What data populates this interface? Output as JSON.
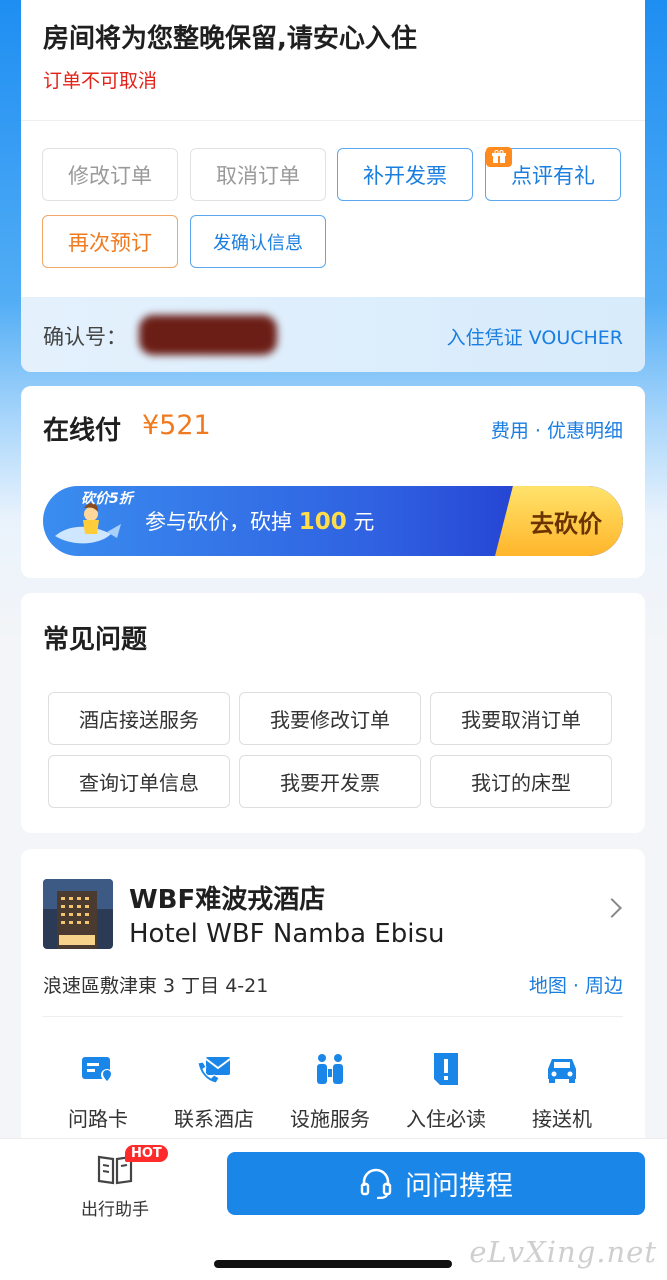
{
  "order_status": {
    "title": "房间将为您整晚保留,请安心入住",
    "subtitle": "订单不可取消"
  },
  "actions": [
    {
      "label": "修改订单",
      "style": "gray"
    },
    {
      "label": "取消订单",
      "style": "gray"
    },
    {
      "label": "补开发票",
      "style": "blue"
    },
    {
      "label": "点评有礼",
      "style": "blue"
    },
    {
      "label": "再次预订",
      "style": "orange"
    },
    {
      "label": "发确认信息",
      "style": "blue"
    }
  ],
  "confirmation": {
    "label": "确认号：",
    "voucher_link": "入住凭证 VOUCHER"
  },
  "payment": {
    "label": "在线付",
    "price": "¥521",
    "fee_link": "费用 · 优惠明细"
  },
  "banner": {
    "tag": "砍价5折",
    "text_prefix": "参与砍价，砍掉",
    "amount": "100",
    "text_suffix": "元",
    "button": "去砍价"
  },
  "faq": {
    "title": "常见问题",
    "items": [
      "酒店接送服务",
      "我要修改订单",
      "我要取消订单",
      "查询订单信息",
      "我要开发票",
      "我订的床型"
    ]
  },
  "hotel": {
    "name_cn": "WBF难波戎酒店",
    "name_en": "Hotel WBF Namba Ebisu",
    "address": "浪速區敷津東 3 丁目 4-21",
    "map_link": "地图 · 周边",
    "services": [
      {
        "label": "问路卡",
        "icon": "direction-card-icon"
      },
      {
        "label": "联系酒店",
        "icon": "phone-mail-icon"
      },
      {
        "label": "设施服务",
        "icon": "facilities-icon"
      },
      {
        "label": "入住必读",
        "icon": "notice-icon"
      },
      {
        "label": "接送机",
        "icon": "car-icon"
      }
    ]
  },
  "bottom_bar": {
    "assistant_label": "出行助手",
    "hot_badge": "HOT",
    "ask_button": "问问携程"
  },
  "watermark": "eLvXing.net",
  "colors": {
    "accent_blue": "#1a7ee0",
    "price_orange": "#f07a1f",
    "alert_red": "#e2231a"
  }
}
